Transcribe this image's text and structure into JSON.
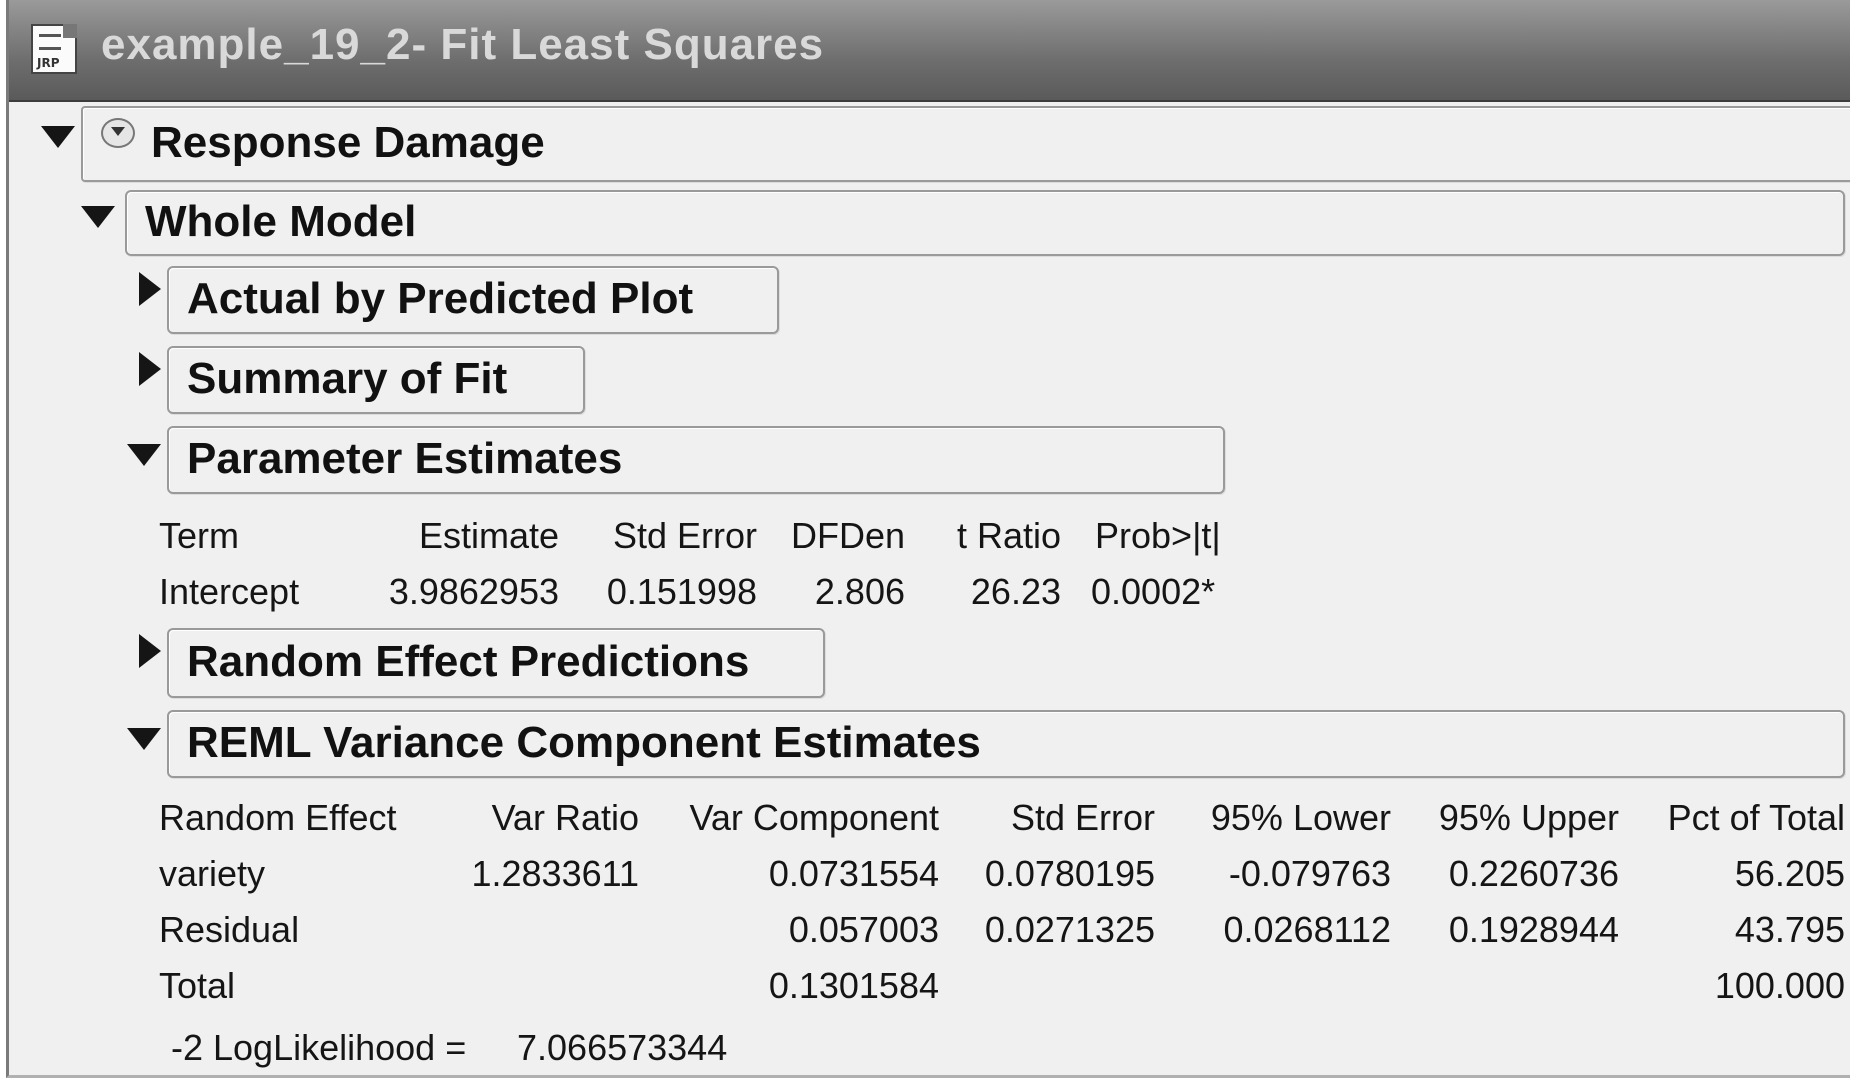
{
  "window": {
    "title": "example_19_2- Fit Least Squares",
    "icon": "jmp-file-icon",
    "icon_text": "JRP"
  },
  "report": {
    "response_title": "Response Damage",
    "whole_model_title": "Whole Model",
    "sections": {
      "actual_by_predicted": "Actual by Predicted Plot",
      "summary_of_fit": "Summary of Fit",
      "parameter_estimates": "Parameter Estimates",
      "random_effect_predictions": "Random Effect Predictions",
      "reml": "REML Variance Component Estimates"
    },
    "parameter_estimates": {
      "columns": [
        "Term",
        "Estimate",
        "Std Error",
        "DFDen",
        "t Ratio",
        "Prob>|t|"
      ],
      "rows": [
        [
          "Intercept",
          "3.9862953",
          "0.151998",
          "2.806",
          "26.23",
          "0.0002*"
        ]
      ]
    },
    "reml": {
      "columns": [
        "Random Effect",
        "Var Ratio",
        "Var Component",
        "Std Error",
        "95% Lower",
        "95% Upper",
        "Pct of Total"
      ],
      "rows": [
        [
          "variety",
          "1.2833611",
          "0.0731554",
          "0.0780195",
          "-0.079763",
          "0.2260736",
          "56.205"
        ],
        [
          "Residual",
          "",
          "0.057003",
          "0.0271325",
          "0.0268112",
          "0.1928944",
          "43.795"
        ],
        [
          "Total",
          "",
          "0.1301584",
          "",
          "",
          "",
          "100.000"
        ]
      ],
      "loglikelihood_label": "-2 LogLikelihood =",
      "loglikelihood_value": "7.066573344"
    }
  }
}
